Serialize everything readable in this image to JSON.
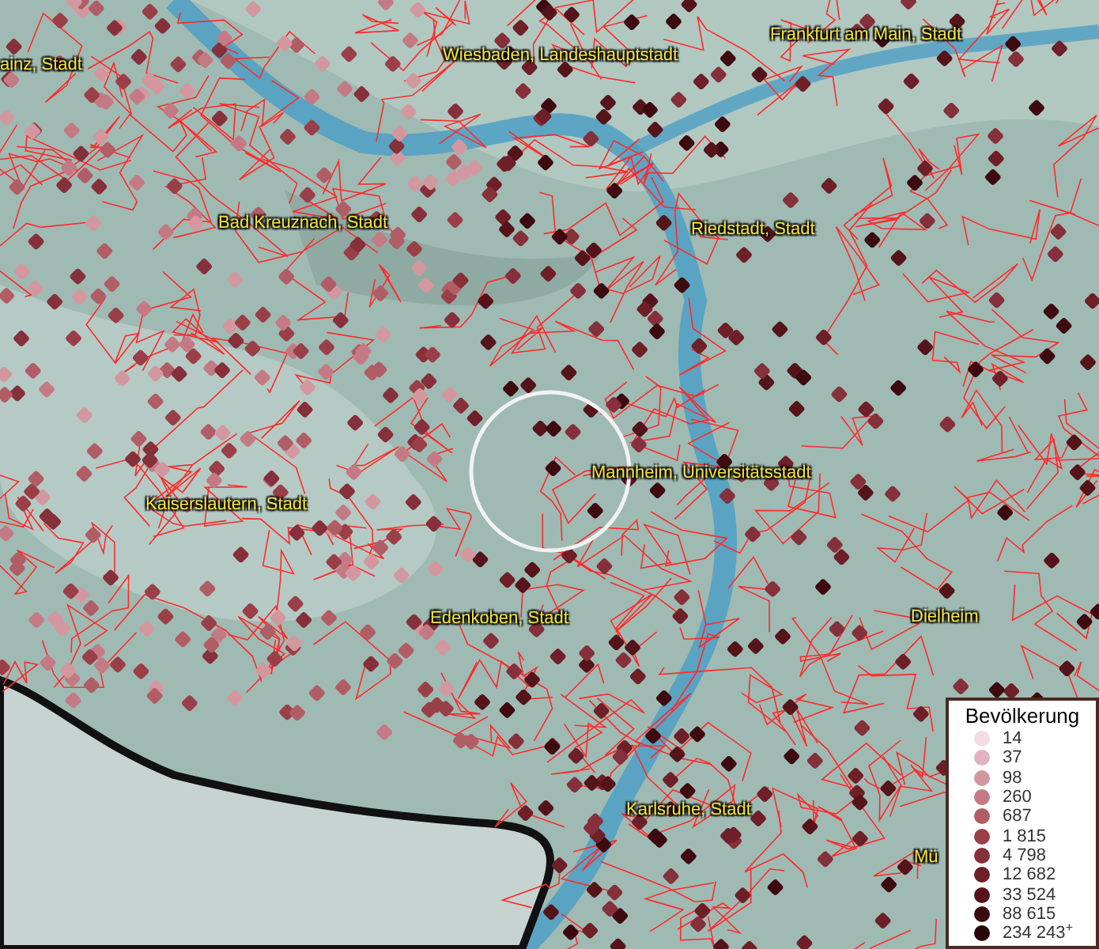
{
  "map": {
    "place_labels": [
      {
        "text": "ainz, Stadt"
      },
      {
        "text": "Wiesbaden, Landeshauptstadt"
      },
      {
        "text": "Frankfurt am Main, Stadt"
      },
      {
        "text": "Bad Kreuznach, Stadt"
      },
      {
        "text": "Riedstadt, Stadt"
      },
      {
        "text": "Mannheim, Universitätsstadt"
      },
      {
        "text": "Kaiserslautern, Stadt"
      },
      {
        "text": "Edenkoben, Stadt"
      },
      {
        "text": "Dielheim"
      },
      {
        "text": "Karlsruhe, Stadt"
      },
      {
        "text": "Mü"
      }
    ]
  },
  "legend": {
    "title": "Bevölkerung",
    "items": [
      {
        "label": "14",
        "color": "#f3dce6"
      },
      {
        "label": "37",
        "color": "#e0b3bf"
      },
      {
        "label": "98",
        "color": "#d3989f"
      },
      {
        "label": "260",
        "color": "#c47a84"
      },
      {
        "label": "687",
        "color": "#b15d66"
      },
      {
        "label": "1 815",
        "color": "#9a3f48"
      },
      {
        "label": "4 798",
        "color": "#85303a"
      },
      {
        "label": "12 682",
        "color": "#6e1f27"
      },
      {
        "label": "33 524",
        "color": "#55141a"
      },
      {
        "label": "88 615",
        "color": "#3d0a0f"
      },
      {
        "label": "234 243$^{+}$",
        "color": "#260407"
      }
    ]
  }
}
